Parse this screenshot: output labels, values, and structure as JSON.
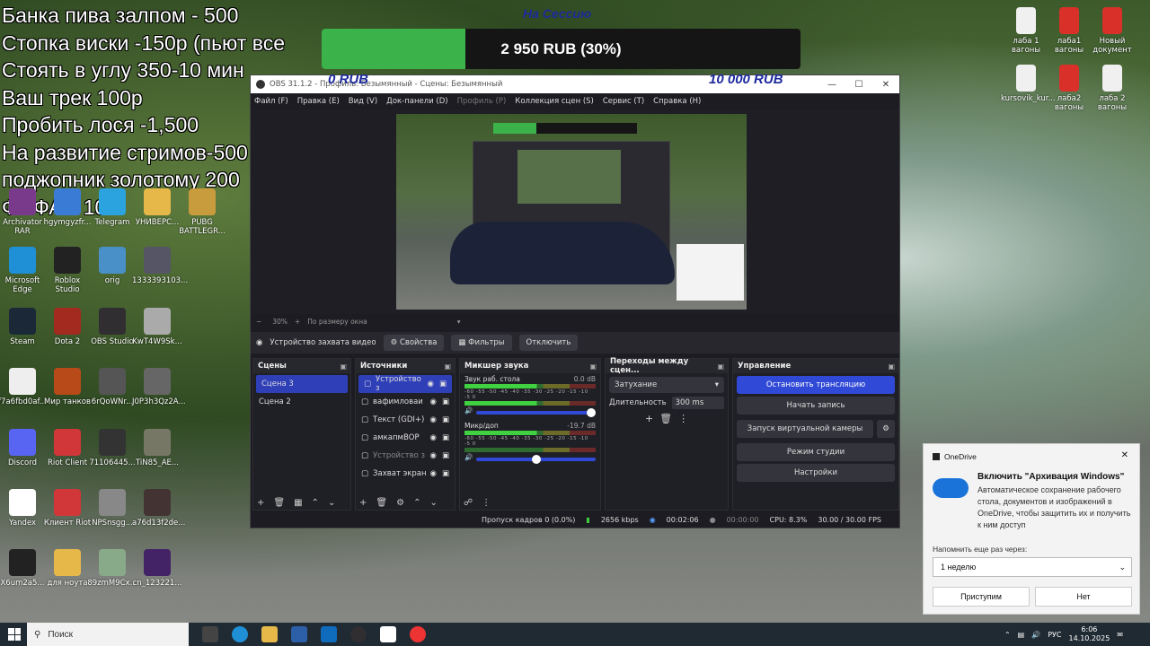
{
  "overlay": {
    "lines": [
      "Банка пива залпом - 500",
      "Стопка виски -150р (пьют все",
      "Стоять в углу 350-10 мин",
      "Ваш трек 100р",
      "Пробить лося -1,500",
      "На развитие стримов-500",
      "поджопник золотому 200",
      "ФОФАН 100"
    ]
  },
  "goal": {
    "title": "На Сессию",
    "text": "2 950 RUB (30%)",
    "progress": 0.3,
    "min": "0 RUB",
    "max": "10 000 RUB"
  },
  "desktop_icons": [
    {
      "label": "Archivator RAR",
      "icon": "rar-icon",
      "color": "#7a3a8c"
    },
    {
      "label": "hgymgyzfr...",
      "icon": "file-icon",
      "color": "#3a7bd5"
    },
    {
      "label": "Telegram",
      "icon": "telegram-icon",
      "color": "#2aa3df"
    },
    {
      "label": "УНИВЕРС...",
      "icon": "folder-icon",
      "color": "#e6b84a"
    },
    {
      "label": "PUBG BATTLEGR...",
      "icon": "pubg-icon",
      "color": "#c89b3c"
    },
    {
      "label": "Microsoft Edge",
      "icon": "edge-icon",
      "color": "#1f8fd6"
    },
    {
      "label": "Roblox Studio",
      "icon": "roblox-icon",
      "color": "#222"
    },
    {
      "label": "orig",
      "icon": "image-icon",
      "color": "#4a90c8"
    },
    {
      "label": "1333393103...",
      "icon": "image-icon",
      "color": "#556"
    },
    {
      "label": "Steam",
      "icon": "steam-icon",
      "color": "#1b2838"
    },
    {
      "label": "Dota 2",
      "icon": "dota-icon",
      "color": "#a32a1e"
    },
    {
      "label": "OBS Studio",
      "icon": "obs-icon",
      "color": "#302e31"
    },
    {
      "label": "KwT4W9Sk...",
      "icon": "image-icon",
      "color": "#aaa"
    },
    {
      "label": "f7a6fbd0af...",
      "icon": "file-icon",
      "color": "#eee"
    },
    {
      "label": "Мир танков",
      "icon": "tanks-icon",
      "color": "#b84a1a"
    },
    {
      "label": "6rQoWNr...",
      "icon": "image-icon",
      "color": "#555"
    },
    {
      "label": "J0P3h3Qz2A...",
      "icon": "image-icon",
      "color": "#666"
    },
    {
      "label": "Discord",
      "icon": "discord-icon",
      "color": "#5865f2"
    },
    {
      "label": "Riot Client",
      "icon": "riot-icon",
      "color": "#d13639"
    },
    {
      "label": "71106445...",
      "icon": "image-icon",
      "color": "#333"
    },
    {
      "label": "TiN85_AE...",
      "icon": "image-icon",
      "color": "#776"
    },
    {
      "label": "Yandex",
      "icon": "yandex-icon",
      "color": "#fff"
    },
    {
      "label": "Клиент Riot",
      "icon": "riot-icon",
      "color": "#d13639"
    },
    {
      "label": "NPSnsgg...",
      "icon": "image-icon",
      "color": "#888"
    },
    {
      "label": "a76d13f2de...",
      "icon": "image-icon",
      "color": "#433"
    },
    {
      "label": "X6um2a5...",
      "icon": "image-icon",
      "color": "#222"
    },
    {
      "label": "для ноута",
      "icon": "folder-icon",
      "color": "#e6b84a"
    },
    {
      "label": "89zmM9Cx...",
      "icon": "image-icon",
      "color": "#8a8"
    },
    {
      "label": "cn_123221...",
      "icon": "image-icon",
      "color": "#426"
    }
  ],
  "right_icons": [
    {
      "label": "лаба 1 вагоны",
      "icon": "docx-icon"
    },
    {
      "label": "лаба1 вагоны",
      "icon": "pdf-icon"
    },
    {
      "label": "Новый документ",
      "icon": "pdf-icon"
    },
    {
      "label": "kursovik_kur...",
      "icon": "docx-icon"
    },
    {
      "label": "лаба2 вагоны",
      "icon": "pdf-icon"
    },
    {
      "label": "лаба 2 вагоны",
      "icon": "docx-icon"
    }
  ],
  "obs": {
    "title": "OBS 31.1.2 - Профиль: Безымянный - Сцены: Безымянный",
    "menu": [
      "Файл (F)",
      "Правка (E)",
      "Вид (V)",
      "Док-панели (D)",
      "Профиль (P)",
      "Коллекция сцен (S)",
      "Сервис (T)",
      "Справка (H)"
    ],
    "zoom": "30%",
    "fit": "По размеру окна",
    "source_bar": {
      "name": "Устройство захвата видео",
      "props": "Свойства",
      "filters": "Фильтры",
      "disable": "Отключить"
    },
    "scenes": {
      "title": "Сцены",
      "items": [
        "Сцена 3",
        "Сцена 2"
      ]
    },
    "sources": {
      "title": "Источники",
      "items": [
        "Устройство з",
        "вафимловаи",
        "Текст (GDI+)",
        "амкапмВОР",
        "Устройство з",
        "Захват экран"
      ]
    },
    "mixer": {
      "title": "Микшер звука",
      "ticks": "-60 -55 -50 -45 -40 -35 -30 -25 -20 -15 -10 -5 0",
      "channels": [
        {
          "name": "Звук раб. стола",
          "db": "0.0 dB",
          "level": 1.0
        },
        {
          "name": "Микр/доп",
          "db": "-19.7 dB",
          "level": 0.5
        }
      ]
    },
    "transitions": {
      "title": "Переходы между сцен...",
      "type": "Затухание",
      "duration_label": "Длительность",
      "duration": "300 ms"
    },
    "controls": {
      "title": "Управление",
      "stop": "Остановить трансляцию",
      "record": "Начать запись",
      "vcam": "Запуск виртуальной камеры",
      "studio": "Режим студии",
      "settings": "Настройки"
    },
    "status": {
      "dropped": "Пропуск кадров 0 (0.0%)",
      "bitrate": "2656 kbps",
      "live": "00:02:06",
      "rec": "00:00:00",
      "cpu": "CPU: 8.3%",
      "fps": "30.00 / 30.00 FPS"
    }
  },
  "onedrive": {
    "app": "OneDrive",
    "title": "Включить \"Архивация Windows\"",
    "body": "Автоматическое сохранение рабочего стола, документов и изображений в OneDrive, чтобы защитить их и получить к ним доступ",
    "remind": "Напомнить еще раз через:",
    "option": "1 неделю",
    "yes": "Приступим",
    "no": "Нет"
  },
  "taskbar": {
    "search": "Поиск",
    "lang": "РУС",
    "time": "6:06",
    "date": "14.10.2025"
  }
}
